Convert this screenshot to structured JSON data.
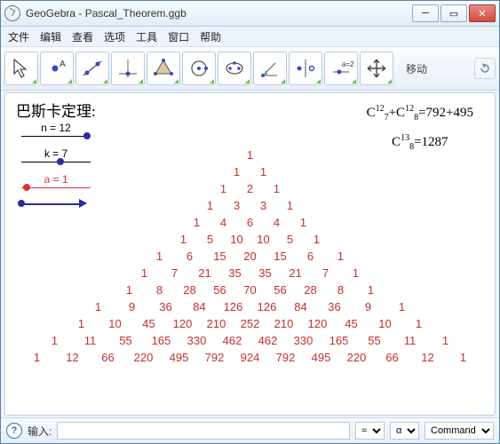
{
  "window": {
    "title": "GeoGebra - Pascal_Theorem.ggb"
  },
  "menu": [
    "文件",
    "编辑",
    "查看",
    "选项",
    "工具",
    "窗口",
    "帮助"
  ],
  "toolbar": {
    "mode_label": "移动"
  },
  "canvas": {
    "title": "巴斯卡定理:",
    "sliders": [
      {
        "name": "n",
        "label": "n = 12"
      },
      {
        "name": "k",
        "label": "k = 7"
      },
      {
        "name": "a",
        "label": "a = 1"
      }
    ],
    "formulas": [
      {
        "sup1": "12",
        "sub1": "7",
        "sup2": "12",
        "sub2": "8",
        "rhs": "792+495"
      },
      {
        "sup": "13",
        "sub": "8",
        "rhs": "1287"
      }
    ],
    "triangle": [
      [
        1
      ],
      [
        1,
        1
      ],
      [
        1,
        2,
        1
      ],
      [
        1,
        3,
        3,
        1
      ],
      [
        1,
        4,
        6,
        4,
        1
      ],
      [
        1,
        5,
        10,
        10,
        5,
        1
      ],
      [
        1,
        6,
        15,
        20,
        15,
        6,
        1
      ],
      [
        1,
        7,
        21,
        35,
        35,
        21,
        7,
        1
      ],
      [
        1,
        8,
        28,
        56,
        70,
        56,
        28,
        8,
        1
      ],
      [
        1,
        9,
        36,
        84,
        126,
        126,
        84,
        36,
        9,
        1
      ],
      [
        1,
        10,
        45,
        120,
        210,
        252,
        210,
        120,
        45,
        10,
        1
      ],
      [
        1,
        11,
        55,
        165,
        330,
        462,
        462,
        330,
        165,
        55,
        11,
        1
      ],
      [
        1,
        12,
        66,
        220,
        495,
        792,
        924,
        792,
        495,
        220,
        66,
        12,
        1
      ]
    ]
  },
  "inputbar": {
    "label": "输入:",
    "value": "",
    "sel1": "≈",
    "sel2": "α",
    "sel3": "Command …"
  }
}
